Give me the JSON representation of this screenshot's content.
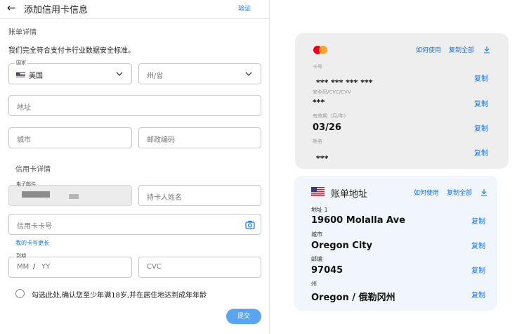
{
  "header": {
    "back_icon": "arrow-left-icon",
    "title": "添加信用卡信息",
    "verify_label": "验证"
  },
  "billing": {
    "section_title": "账单详情",
    "security_notice": "我们完全符合支付卡行业数据安全标准。",
    "country_label": "国家",
    "country_value": "美国",
    "state_placeholder": "州/省",
    "address_placeholder": "地址",
    "city_placeholder": "城市",
    "postal_placeholder": "邮政编码"
  },
  "card_details": {
    "section_title": "信用卡详情",
    "email_label": "电子邮件",
    "holder_placeholder": "持卡人姓名",
    "card_number_placeholder": "信用卡卡号",
    "longer_card_link": "我的卡号更长",
    "expiry_label": "到期",
    "expiry_mm": "MM",
    "expiry_slash": "/",
    "expiry_yy": "YY",
    "cvc_placeholder": "CVC",
    "age_consent": "勾选此处,确认您至少年满18岁,并在居住地达到成年年龄",
    "submit_label": "提交"
  },
  "card_panel": {
    "how_to_use": "如何使用",
    "copy_all": "复制全部",
    "brand_icon": "mastercard-icon",
    "download_icon": "download-icon",
    "number_label": "卡号",
    "number_value": "***   ***   ***     ***",
    "cvv_label": "安全码/CVC/CVV",
    "cvv_value": "***",
    "expiry_label": "有效期（月/年）",
    "expiry_value": "03/26",
    "name_label": "姓名",
    "name_value": "***",
    "copy_label": "复制"
  },
  "address_panel": {
    "title": "账单地址",
    "how_to_use": "如何使用",
    "copy_all": "复制全部",
    "flag_icon": "us-flag-icon",
    "address_label": "地址 1",
    "address_value": "19600 Molalla Ave",
    "city_label": "城市",
    "city_value": "Oregon City",
    "zip_label": "邮编",
    "zip_value": "97045",
    "state_label": "州",
    "state_value": "Oregon / 俄勒冈州",
    "copy_label": "复制"
  },
  "colors": {
    "accent": "#1a73e8",
    "submit": "#5ba4ee",
    "card_bg": "#eeeeee",
    "address_bg": "#f0f6fb"
  }
}
